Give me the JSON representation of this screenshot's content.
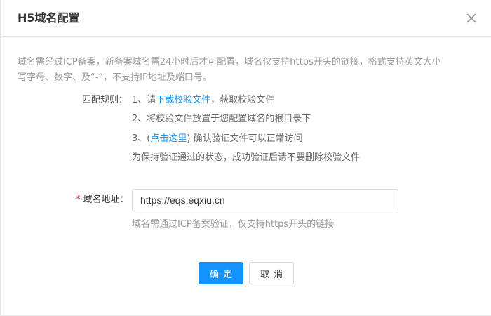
{
  "dialog": {
    "title": "H5域名配置",
    "close_icon": "close-icon"
  },
  "notice": {
    "line1": "域名需经过ICP备案，新备案域名需24小时后才可配置，域名仅支持https开头的链接，格式支持英文大小",
    "line2": "写字母、数字、及“-”，不支持IP地址及端口号。"
  },
  "rules": {
    "label": "匹配规则：",
    "step1_prefix": "1、请",
    "step1_link": "下载校验文件",
    "step1_suffix": "，获取校验文件",
    "step2": "2、将校验文件放置于您配置域名的根目录下",
    "step3_prefix": "3、(",
    "step3_link": "点击这里",
    "step3_suffix": ") 确认验证文件可以正常访问",
    "note": "为保持验证通过的状态，成功验证后请不要删除校验文件"
  },
  "domain_field": {
    "required_mark": "*",
    "label": "域名地址：",
    "value": "https://eqs.eqxiu.cn",
    "hint": "域名需通过ICP备案验证，仅支持https开头的链接"
  },
  "footer": {
    "ok_label": "确定",
    "cancel_label": "取消"
  },
  "colors": {
    "accent": "#1593ff",
    "required": "#f5222d"
  }
}
